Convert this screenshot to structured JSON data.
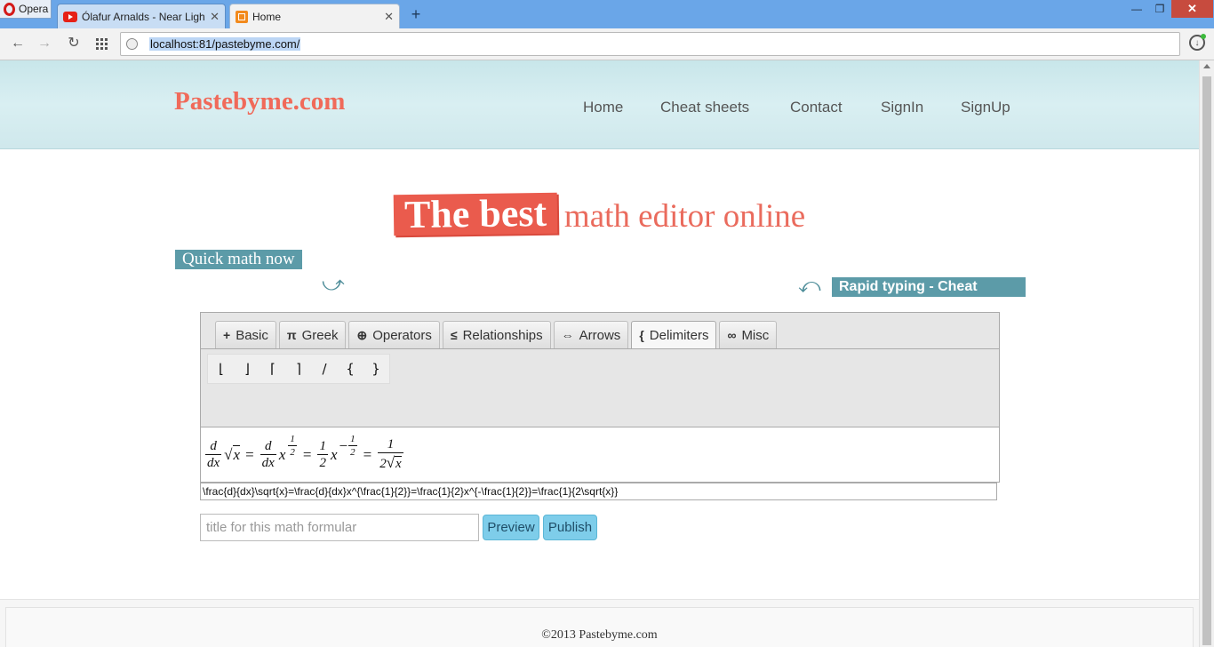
{
  "browser": {
    "opera_label": "Opera",
    "tabs": [
      {
        "title": "Ólafur Arnalds - Near Light",
        "icon": "youtube-icon",
        "close": "✕"
      },
      {
        "title": "Home",
        "icon": "home-favicon",
        "close": "✕"
      }
    ],
    "new_tab": "+",
    "window_controls": {
      "minimize": "—",
      "restore": "❐",
      "close": "✕"
    },
    "url": "localhost:81/pastebyme.com/"
  },
  "site": {
    "logo": "Pastebyme.com",
    "nav": [
      "Home",
      "Cheat sheets",
      "Contact",
      "SignIn",
      "SignUp"
    ]
  },
  "hero": {
    "badge": "The best",
    "text": "math editor online",
    "left_label": "Quick math now",
    "right_label": "Rapid typing - Cheat"
  },
  "editor": {
    "tabs": [
      {
        "icon": "+",
        "label": "Basic"
      },
      {
        "icon": "π",
        "label": "Greek"
      },
      {
        "icon": "⊕",
        "label": "Operators"
      },
      {
        "icon": "≤",
        "label": "Relationships"
      },
      {
        "icon": "⇔",
        "label": "Arrows"
      },
      {
        "icon": "{",
        "label": "Delimiters"
      },
      {
        "icon": "∞",
        "label": "Misc"
      }
    ],
    "active_tab": "Delimiters",
    "symbols": [
      "⌊",
      "⌋",
      "⌈",
      "⌉",
      "/",
      "{",
      "}"
    ],
    "formula": {
      "d": "d",
      "dx": "dx",
      "x": "x",
      "one": "1",
      "two": "2",
      "eq": "=",
      "minus": "−"
    },
    "latex": "\\frac{d}{dx}\\sqrt{x}=\\frac{d}{dx}x^{\\frac{1}{2}}=\\frac{1}{2}x^{-\\frac{1}{2}}=\\frac{1}{2\\sqrt{x}}",
    "title_placeholder": "title for this math formular",
    "preview_button": "Preview",
    "publish_button": "Publish"
  },
  "footer": {
    "copyright": "©2013 Pastebyme.com"
  }
}
